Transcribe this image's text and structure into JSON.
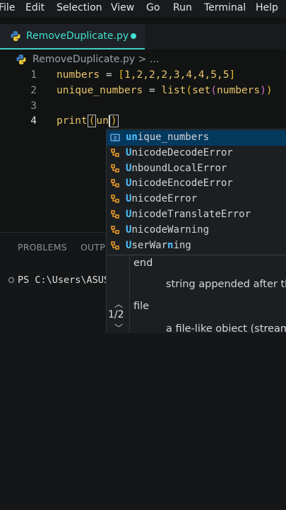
{
  "menu": [
    "File",
    "Edit",
    "Selection",
    "View",
    "Go",
    "Run",
    "Terminal",
    "Help"
  ],
  "tab": {
    "filename": "RemoveDuplicate.py",
    "unsaved": true
  },
  "breadcrumb": {
    "file": "RemoveDuplicate.py",
    "sep": ">",
    "more": "..."
  },
  "editor": {
    "line_numbers": [
      "1",
      "2",
      "3",
      "4"
    ],
    "line1": {
      "var": "numbers",
      "op": " = ",
      "open": "[",
      "items": "1,2,2,2,3,4,4,5,5",
      "close": "]"
    },
    "line2": {
      "var": "unique_numbers",
      "op": " = ",
      "fn1": "list",
      "p1": "(",
      "fn2": "set",
      "p2": "(",
      "arg": "numbers",
      "c2": ")",
      "c1": ")"
    },
    "line4": {
      "fn": "print",
      "open": "(",
      "typed": "un",
      "close": ")"
    }
  },
  "suggestions": [
    {
      "match": "un",
      "rest": "ique_numbers",
      "icon": "variable-icon",
      "selected": true
    },
    {
      "match": "U",
      "rest": "nicodeDecodeError",
      "icon": "class-icon"
    },
    {
      "match": "U",
      "rest": "nboundLocalError",
      "icon": "class-icon"
    },
    {
      "match": "U",
      "rest": "nicodeEncodeError",
      "icon": "class-icon"
    },
    {
      "match": "U",
      "rest": "nicodeError",
      "icon": "class-icon"
    },
    {
      "match": "U",
      "rest": "nicodeTranslateError",
      "icon": "class-icon"
    },
    {
      "match": "U",
      "rest": "nicodeWarning",
      "icon": "class-icon"
    },
    {
      "match": "U",
      "rest": "serWar",
      "match2": "n",
      "rest2": "ing",
      "icon": "class-icon"
    }
  ],
  "panel": {
    "tabs": [
      "PROBLEMS",
      "OUTPU"
    ],
    "terminal_prompt": "PS C:\\Users\\ASUS"
  },
  "signature": {
    "count": "1/2",
    "end_label": "end",
    "end_desc": "string appended after th",
    "file_label": "file",
    "file_desc": "a file-like obiect (stream)"
  }
}
